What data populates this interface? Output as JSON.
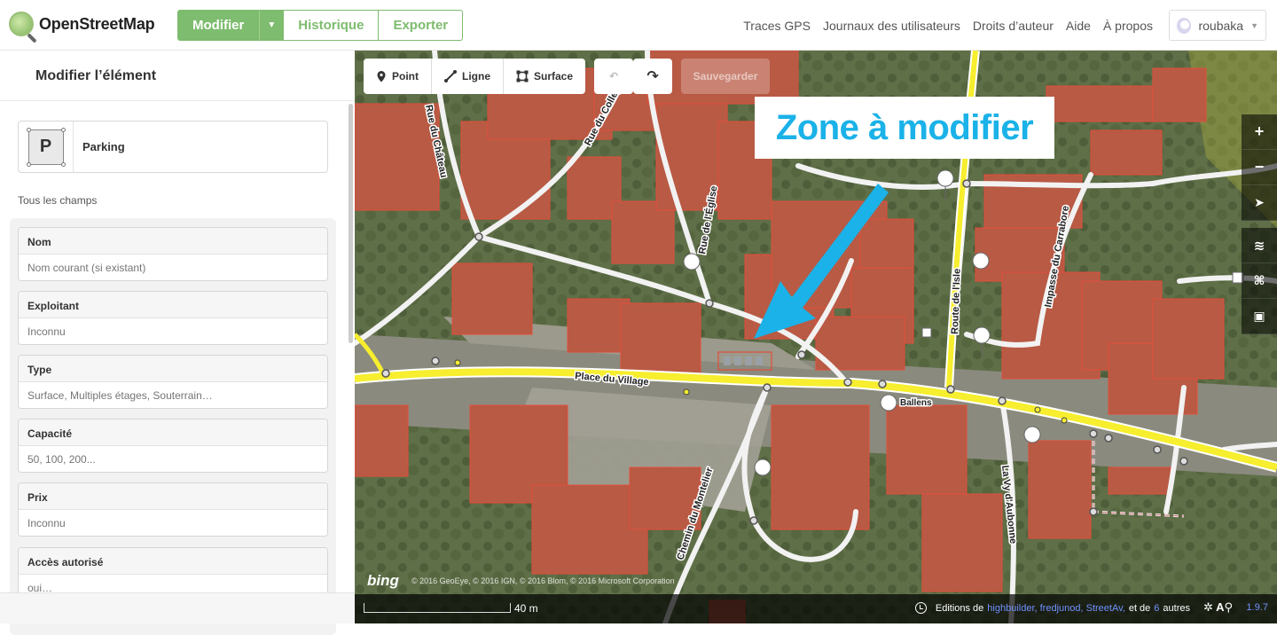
{
  "app": {
    "name": "OpenStreetMap"
  },
  "nav": {
    "tabs": [
      "Modifier",
      "Historique",
      "Exporter"
    ],
    "links": [
      "Traces GPS",
      "Journaux des utilisateurs",
      "Droits d’auteur",
      "Aide",
      "À propos"
    ],
    "user": "roubaka"
  },
  "sidebar": {
    "title": "Modifier l’élément",
    "preset": {
      "icon_letter": "P",
      "name": "Parking"
    },
    "all_fields_label": "Tous les champs",
    "fields": [
      {
        "label": "Nom",
        "placeholder": "Nom courant (si existant)"
      },
      {
        "label": "Exploitant",
        "placeholder": "Inconnu"
      },
      {
        "label": "Type",
        "placeholder": "Surface, Multiples étages, Souterrain…"
      },
      {
        "label": "Capacité",
        "placeholder": "50, 100, 200..."
      },
      {
        "label": "Prix",
        "placeholder": "Inconnu"
      },
      {
        "label": "Accès autorisé",
        "placeholder": "oui…"
      }
    ]
  },
  "toolbar": {
    "point": "Point",
    "line": "Ligne",
    "area": "Surface",
    "save": "Sauvegarder"
  },
  "map": {
    "annotation": "Zone à modifier",
    "annotation_color": "#1ab2e8",
    "street_labels": [
      "Place du Village",
      "Rue du Collège",
      "Rue du Château",
      "Rue de l'Église",
      "Route de l'Isle",
      "Impasse du Carrabore",
      "La Vy d'Aubonne",
      "Chemin du Montelier",
      "Ballens"
    ],
    "bing": "bing",
    "imagery_copyright": "© 2016 GeoEye, © 2016 IGN, © 2016 Blom, © 2016 Microsoft Corporation",
    "scale": "40 m",
    "attribution": {
      "prefix": "Editions de",
      "users": "highbuilder, fredjunod, StreetAv,",
      "mid": "et de",
      "count": "6",
      "suffix": "autres"
    },
    "version": "1.9.7"
  },
  "icons": {
    "point": "map-pin-icon",
    "line": "line-icon",
    "area": "area-icon",
    "undo": "undo-icon",
    "redo": "redo-icon",
    "zoom_in": "zoom-in-icon",
    "zoom_out": "zoom-out-icon",
    "geolocate": "geolocate-icon",
    "layers": "layers-icon",
    "map_data": "map-data-icon",
    "help": "help-icon"
  }
}
